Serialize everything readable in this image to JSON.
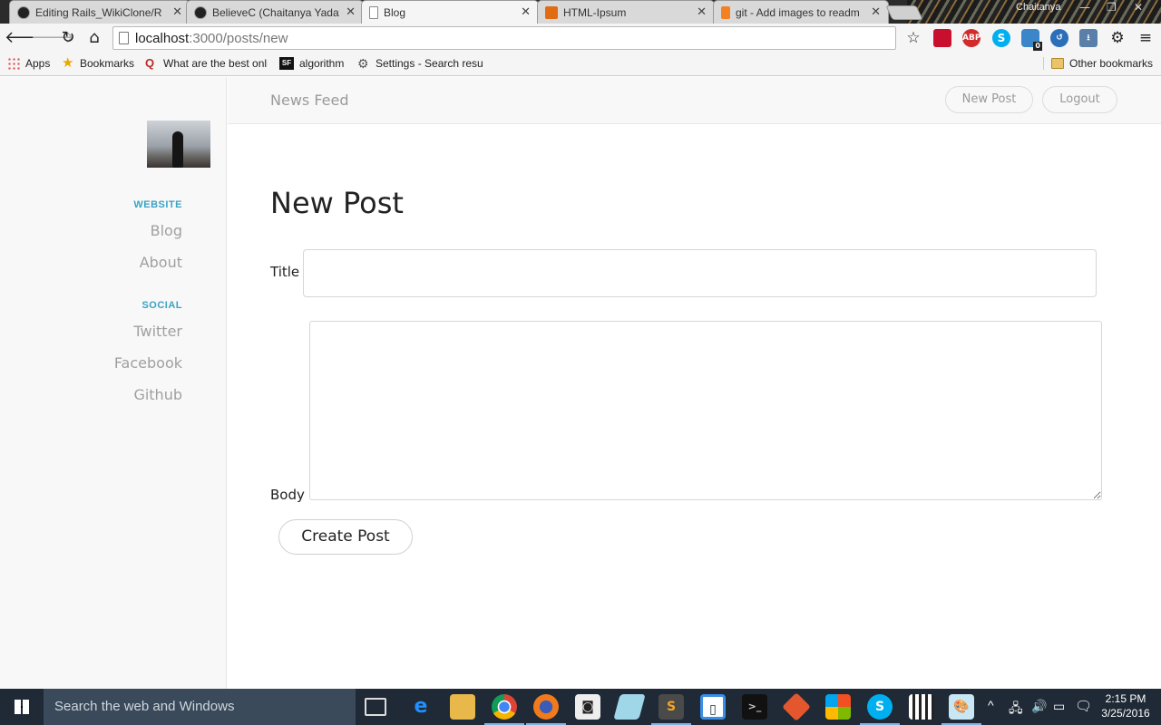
{
  "browser": {
    "tabs": [
      {
        "title": "Editing Rails_WikiClone/R",
        "icon": "github-icon",
        "color": "#222222"
      },
      {
        "title": "BelieveC (Chaitanya Yadav",
        "icon": "github-icon",
        "color": "#222222"
      },
      {
        "title": "Blog",
        "icon": "page-icon",
        "color": "#ffffff"
      },
      {
        "title": "HTML-Ipsum",
        "icon": "html-ipsum-icon",
        "color": "#e06b12"
      },
      {
        "title": "git - Add images to readm",
        "icon": "stackoverflow-icon",
        "color": "#f48024"
      }
    ],
    "user_name": "Chaitanya",
    "url_host": "localhost",
    "url_path": ":3000/posts/new",
    "bookmarks": [
      {
        "label": "Apps",
        "icon": "apps-grid-icon"
      },
      {
        "label": "Bookmarks",
        "icon": "star-icon"
      },
      {
        "label": "What are the best onli",
        "icon": "quora-icon"
      },
      {
        "label": "algorithm",
        "icon": "sf-icon"
      },
      {
        "label": "Settings - Search resu",
        "icon": "gear-icon"
      }
    ],
    "other_bookmarks": "Other bookmarks",
    "extension_badge": "0"
  },
  "site": {
    "brand": "News Feed",
    "nav": {
      "new_post": "New Post",
      "logout": "Logout"
    },
    "sidebar": {
      "website_heading": "WEBSITE",
      "website_links": [
        "Blog",
        "About"
      ],
      "social_heading": "SOCIAL",
      "social_links": [
        "Twitter",
        "Facebook",
        "Github"
      ]
    }
  },
  "form": {
    "heading": "New Post",
    "title_label": "Title",
    "title_value": "",
    "body_label": "Body",
    "body_value": "",
    "submit_label": "Create Post"
  },
  "taskbar": {
    "search_placeholder": "Search the web and Windows",
    "time": "2:15 PM",
    "date": "3/25/2016"
  },
  "colors": {
    "sidebar_heading": "#3aa3c4",
    "taskbar_bg": "#1f2a36"
  }
}
